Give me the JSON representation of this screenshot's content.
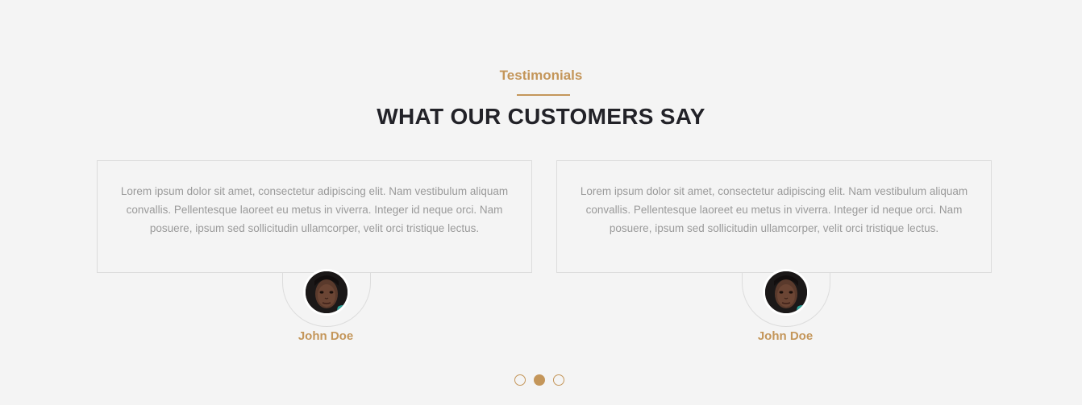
{
  "section": {
    "eyebrow": "Testimonials",
    "title": "WHAT OUR CUSTOMERS SAY"
  },
  "testimonials": [
    {
      "text": "Lorem ipsum dolor sit amet, consectetur adipiscing elit. Nam vestibulum aliquam convallis. Pellentesque laoreet eu metus in viverra. Integer id neque orci. Nam posuere, ipsum sed sollicitudin ullamcorper, velit orci tristique lectus.",
      "name": "John Doe"
    },
    {
      "text": "Lorem ipsum dolor sit amet, consectetur adipiscing elit. Nam vestibulum aliquam convallis. Pellentesque laoreet eu metus in viverra. Integer id neque orci. Nam posuere, ipsum sed sollicitudin ullamcorper, velit orci tristique lectus.",
      "name": "John Doe"
    }
  ],
  "pagination": {
    "count": 3,
    "active_index": 1
  },
  "colors": {
    "accent": "#c4965a",
    "background": "#f4f4f4",
    "title": "#222228",
    "body_text": "#9a9a9a",
    "border": "#dcdcdc"
  }
}
